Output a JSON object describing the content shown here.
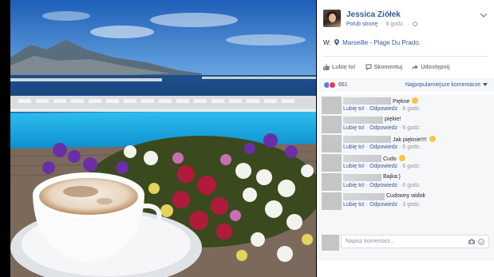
{
  "post": {
    "author": "Jessica Ziółek",
    "page_action": "Polub stronę",
    "time": "6 godz.",
    "location_prefix": "W:",
    "location": "Marseille - Plage Du Prado."
  },
  "actions": {
    "like": "Lubię to!",
    "comment": "Skomentuj",
    "share": "Udostępnij"
  },
  "stats": {
    "reaction_count": "661",
    "sort_label": "Najpopularniejsze komentarze"
  },
  "comments": [
    {
      "text": "Piękne",
      "emoji": "smile-emoji",
      "like": "Lubię to!",
      "reply": "Odpowiedz",
      "time": "6 godz."
    },
    {
      "text": "piękie!",
      "emoji": "",
      "like": "Lubię to!",
      "reply": "Odpowiedz",
      "time": "6 godz."
    },
    {
      "text": "Jak pięknie!!!!",
      "emoji": "wink-emoji",
      "like": "Lubię to!",
      "reply": "Odpowiedz",
      "time": "6 godz."
    },
    {
      "text": "Cudo",
      "emoji": "heart-eyes-emoji",
      "like": "Lubię to!",
      "reply": "Odpowiedz",
      "time": "6 godz."
    },
    {
      "text": "Bajka:)",
      "emoji": "",
      "like": "Lubię to!",
      "reply": "Odpowiedz",
      "time": "6 godz."
    },
    {
      "text": "Cudowny widok",
      "emoji": "",
      "like": "Lubię to!",
      "reply": "Odpowiedz",
      "time": "3 godz."
    }
  ],
  "composer": {
    "placeholder": "Napisz komentarz..."
  },
  "colors": {
    "link": "#365899",
    "like_reaction": "#4f80e1",
    "love_reaction": "#f0364c",
    "pool": "#1fa6e2",
    "sky": "#2c6fc4"
  },
  "icons": [
    "globe-icon",
    "location-pin-icon",
    "thumb-up-icon",
    "comment-icon",
    "share-icon",
    "camera-icon",
    "smiley-icon",
    "chevron-down-icon"
  ]
}
